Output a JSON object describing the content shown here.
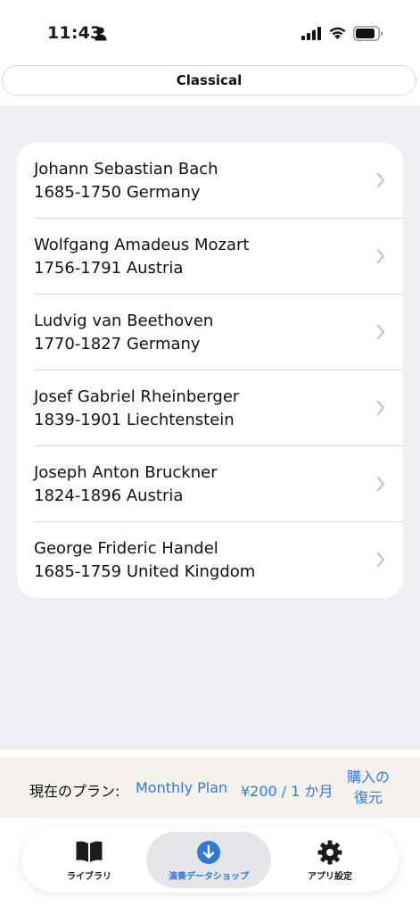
{
  "status_bar": {
    "time": "11:43",
    "icons": [
      "person-icon",
      "signal-icon",
      "wifi-icon",
      "battery-icon"
    ]
  },
  "header": {
    "title": "Classical"
  },
  "composers": [
    {
      "name": "Johann Sebastian Bach",
      "info": "1685-1750  Germany"
    },
    {
      "name": "Wolfgang Amadeus Mozart",
      "info": "1756-1791  Austria"
    },
    {
      "name": "Ludvig van Beethoven",
      "info": "1770-1827  Germany"
    },
    {
      "name": "Josef Gabriel Rheinberger",
      "info": "1839-1901  Liechtenstein"
    },
    {
      "name": "Joseph Anton Bruckner",
      "info": "1824-1896  Austria"
    },
    {
      "name": "George Frideric Handel",
      "info": "1685-1759  United Kingdom"
    }
  ],
  "plan": {
    "label": "現在のプラン:",
    "name": "Monthly Plan",
    "price": "¥200 / 1 か月",
    "restore_line1": "購入の",
    "restore_line2": "復元"
  },
  "tabs": [
    {
      "label": "ライブラリ",
      "icon": "book-icon",
      "active": false
    },
    {
      "label": "演奏データショップ",
      "icon": "download-icon",
      "active": true
    },
    {
      "label": "アプリ設定",
      "icon": "gear-icon",
      "active": false
    }
  ],
  "colors": {
    "accent": "#2f7ad9",
    "background": "#efeff4",
    "plan_bar": "#f4f1ed"
  }
}
